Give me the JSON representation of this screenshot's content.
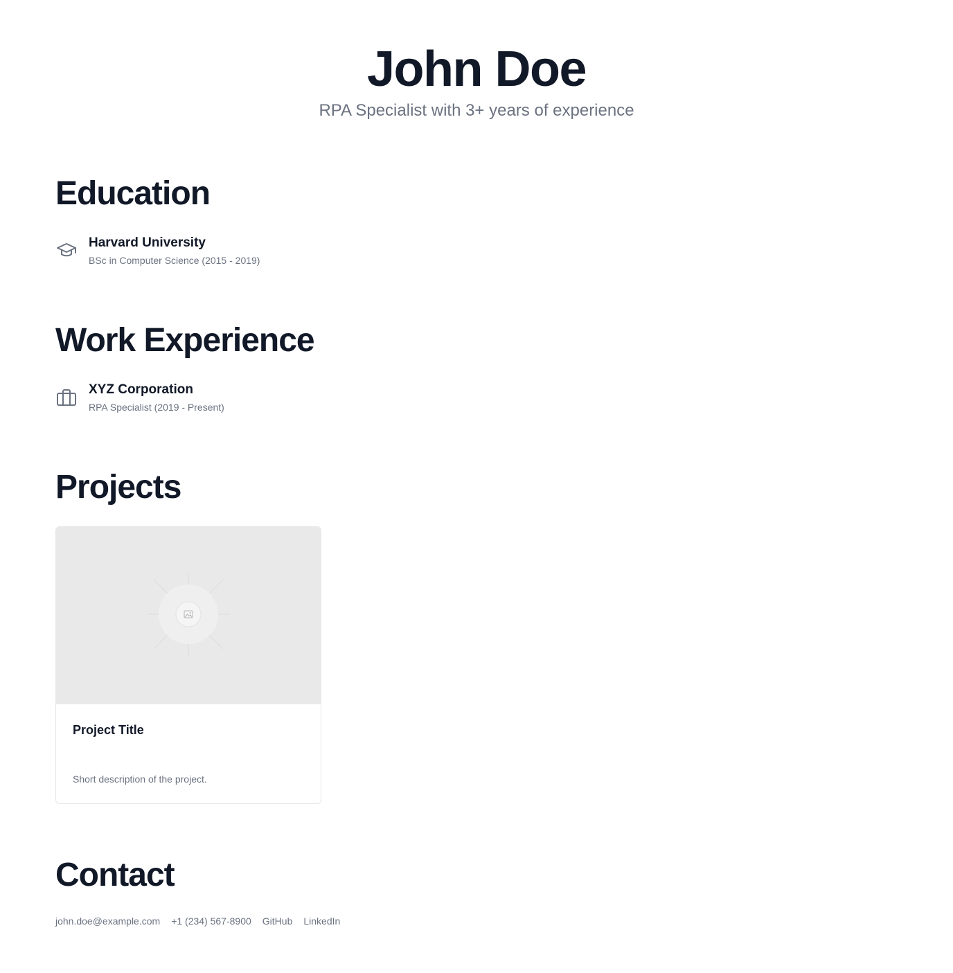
{
  "header": {
    "name": "John Doe",
    "tagline": "RPA Specialist with 3+ years of experience"
  },
  "education": {
    "title": "Education",
    "items": [
      {
        "icon": "graduation-cap-icon",
        "institution": "Harvard University",
        "detail": "BSc in Computer Science (2015 - 2019)"
      }
    ]
  },
  "work": {
    "title": "Work Experience",
    "items": [
      {
        "icon": "briefcase-icon",
        "company": "XYZ Corporation",
        "detail": "RPA Specialist (2019 - Present)"
      }
    ]
  },
  "projects": {
    "title": "Projects",
    "items": [
      {
        "image_icon": "image-placeholder-icon",
        "title": "Project Title",
        "description": "Short description of the project."
      }
    ]
  },
  "contact": {
    "title": "Contact",
    "links": [
      "john.doe@example.com",
      "+1 (234) 567-8900",
      "GitHub",
      "LinkedIn"
    ]
  },
  "colors": {
    "heading": "#111827",
    "muted": "#6b7280",
    "placeholder_bg": "#e9e9e9",
    "border": "#e5e7eb"
  }
}
